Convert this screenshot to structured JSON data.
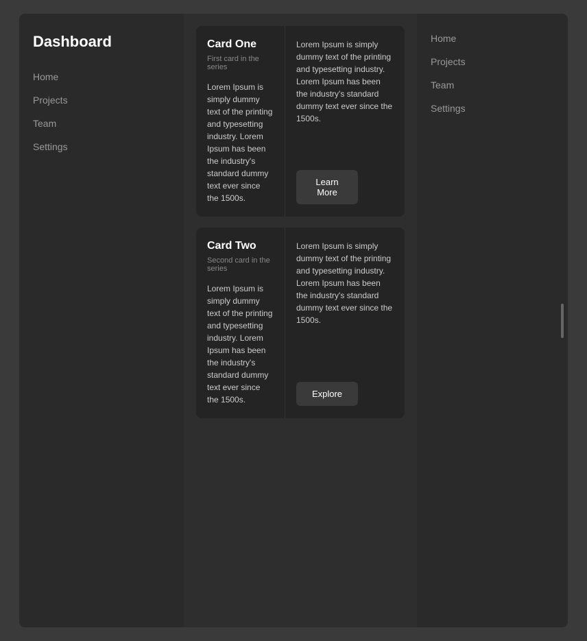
{
  "sidebar": {
    "title": "Dashboard",
    "nav_items": [
      {
        "label": "Home"
      },
      {
        "label": "Projects"
      },
      {
        "label": "Team"
      },
      {
        "label": "Settings"
      }
    ]
  },
  "right_sidebar": {
    "nav_items": [
      {
        "label": "Home"
      },
      {
        "label": "Projects"
      },
      {
        "label": "Team"
      },
      {
        "label": "Settings"
      }
    ]
  },
  "cards": [
    {
      "id": "card-one",
      "title": "Card One",
      "subtitle": "First card in the series",
      "left_body": "Lorem Ipsum is simply dummy text of the printing and typesetting industry. Lorem Ipsum has been the industry's standard dummy text ever since the 1500s.",
      "right_body": "Lorem Ipsum is simply dummy text of the printing and typesetting industry. Lorem Ipsum has been the industry's standard dummy text ever since the 1500s.",
      "button_label": "Learn More"
    },
    {
      "id": "card-two",
      "title": "Card Two",
      "subtitle": "Second card in the series",
      "left_body": "Lorem Ipsum is simply dummy text of the printing and typesetting industry. Lorem Ipsum has been the industry's standard dummy text ever since the 1500s.",
      "right_body": "Lorem Ipsum is simply dummy text of the printing and typesetting industry. Lorem Ipsum has been the industry's standard dummy text ever since the 1500s.",
      "button_label": "Explore"
    }
  ]
}
